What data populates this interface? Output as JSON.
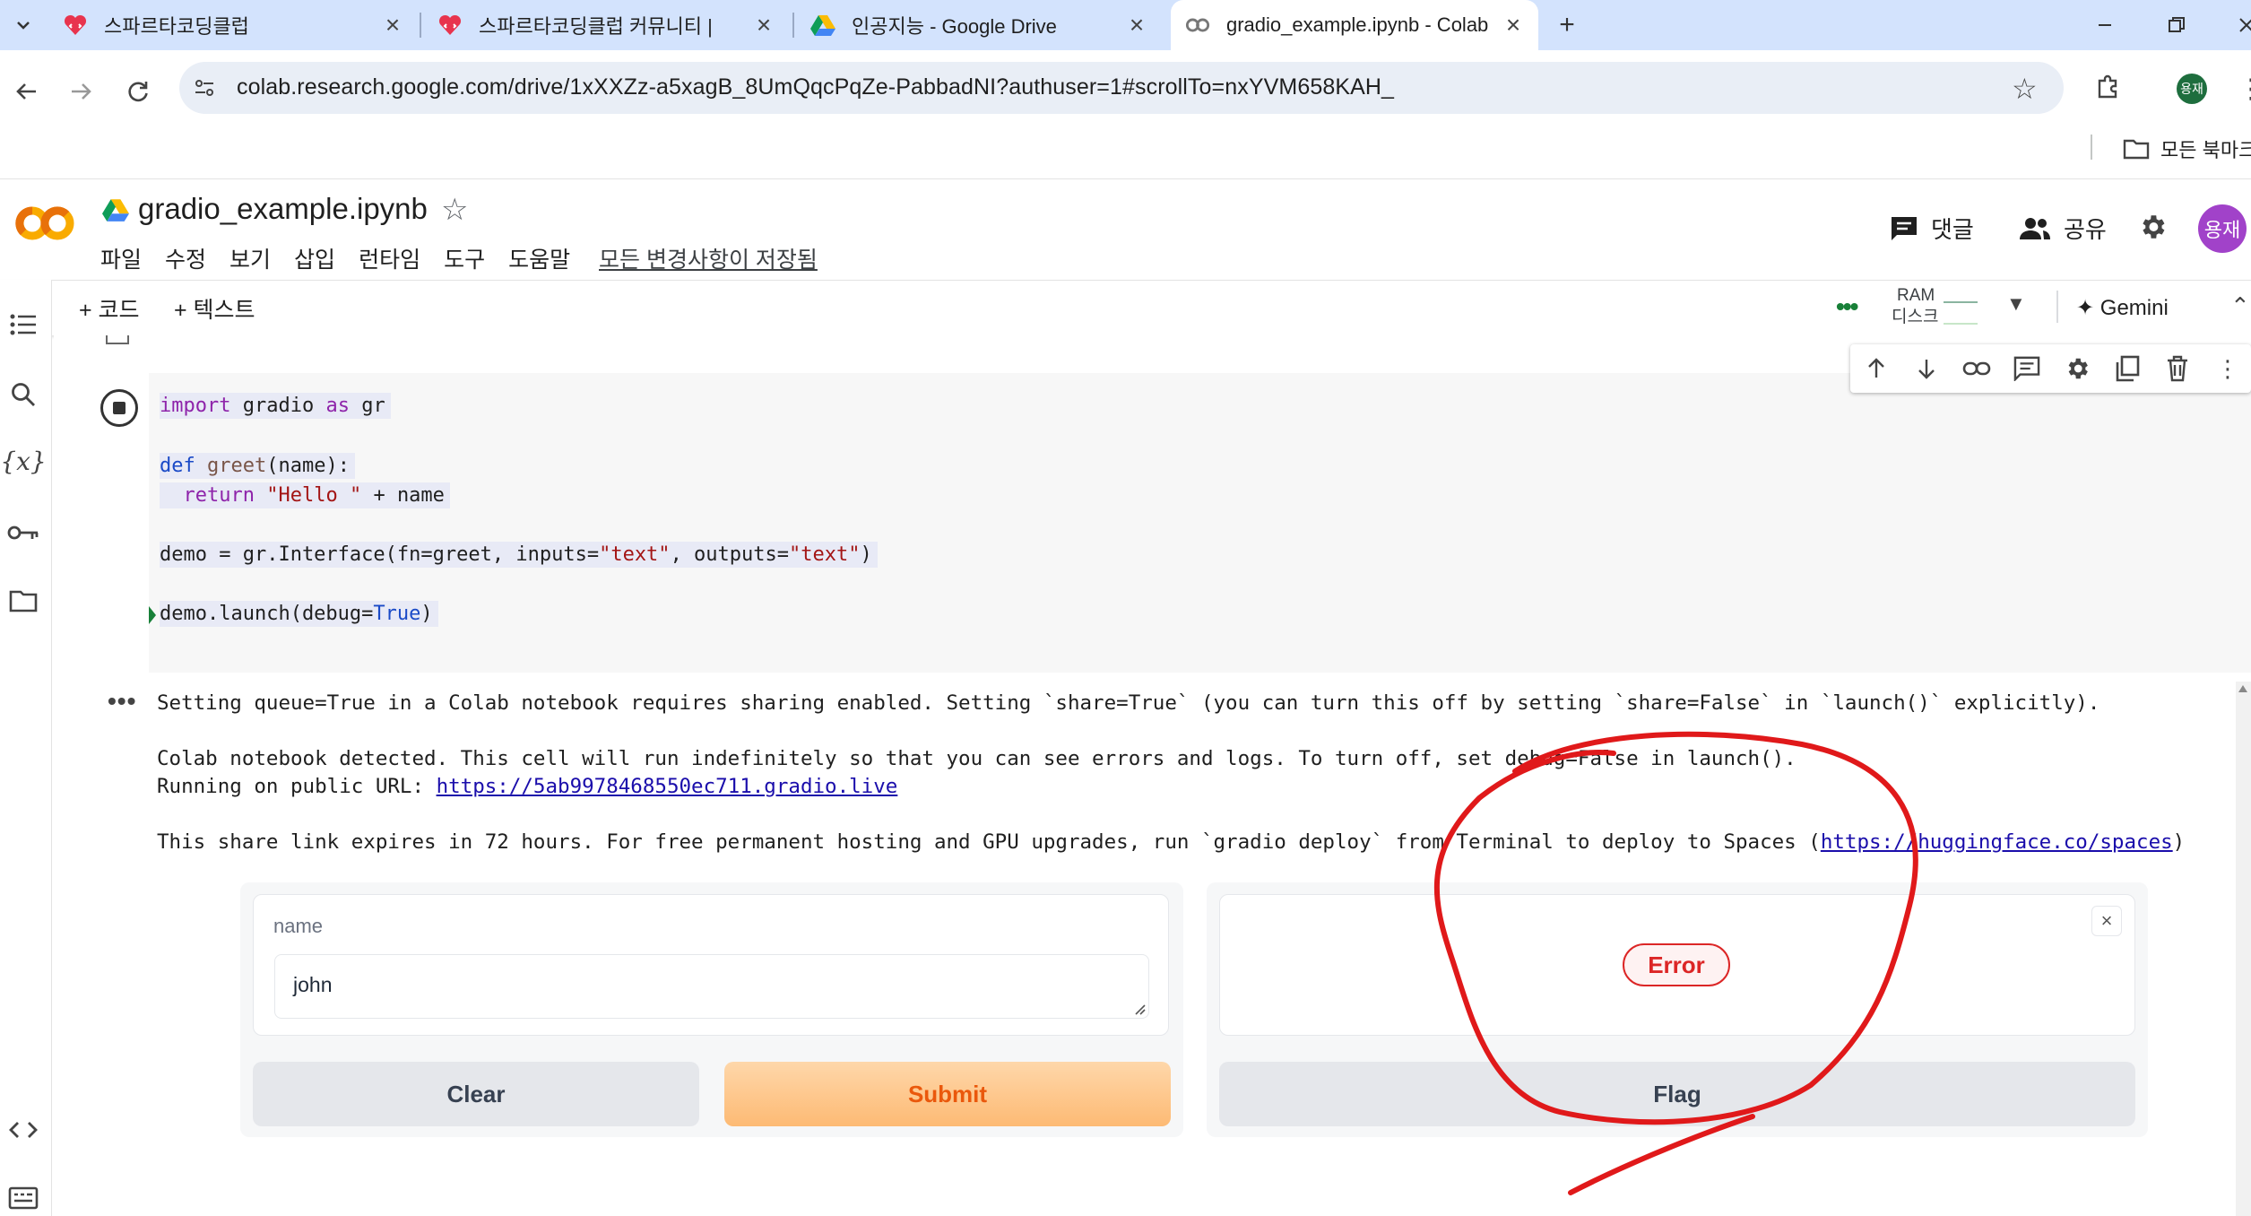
{
  "browser": {
    "tabs": [
      {
        "title": "스파르타코딩클럽",
        "icon": "heart-code-icon"
      },
      {
        "title": "스파르타코딩클럽 커뮤니티 | ",
        "icon": "heart-code-icon"
      },
      {
        "title": "인공지능 - Google Drive",
        "icon": "google-drive-icon"
      },
      {
        "title": "gradio_example.ipynb - Colab",
        "icon": "colab-icon"
      }
    ],
    "new_tab_label": "+",
    "url": "colab.research.google.com/drive/1xXXZz-a5xagB_8UmQqcPqZe-PabbadNI?authuser=1#scrollTo=nxYVM658KAH_",
    "profile_initials": "용재",
    "bookmarks_folder": "모든 북마크"
  },
  "colab": {
    "notebook_title": "gradio_example.ipynb",
    "menu": [
      "파일",
      "수정",
      "보기",
      "삽입",
      "런타임",
      "도구",
      "도움말"
    ],
    "save_status": "모든 변경사항이 저장됨",
    "comment_label": "댓글",
    "share_label": "공유",
    "avatar_initials": "용재",
    "toolbar": {
      "add_code": "+ 코드",
      "add_text": "+ 텍스트",
      "ram_label": "RAM",
      "disk_label": "디스크",
      "gemini_label": "Gemini"
    }
  },
  "cell": {
    "code_lines": [
      "import gradio as gr",
      "",
      "def greet(name):",
      "  return \"Hello \" + name",
      "",
      "demo = gr.Interface(fn=greet, inputs=\"text\", outputs=\"text\")",
      "",
      "demo.launch(debug=True)"
    ]
  },
  "output": {
    "line1": "Setting queue=True in a Colab notebook requires sharing enabled. Setting `share=True` (you can turn this off by setting `share=False` in `launch()` explicitly).",
    "line2": "Colab notebook detected. This cell will run indefinitely so that you can see errors and logs. To turn off, set debug=False in launch().",
    "line3_prefix": "Running on public URL: ",
    "line3_link": "https://5ab9978468550ec711.gradio.live",
    "line4_prefix": "This share link expires in 72 hours. For free permanent hosting and GPU upgrades, run `gradio deploy` from Terminal to deploy to Spaces (",
    "line4_link": "https://huggingface.co/spaces",
    "line4_suffix": ")"
  },
  "gradio": {
    "input_label": "name",
    "input_value": "john",
    "error_badge": "Error",
    "clear_button": "Clear",
    "submit_button": "Submit",
    "flag_button": "Flag"
  },
  "colors": {
    "annotation_red": "#e0191a",
    "submit_orange": "#ea580c",
    "error_red": "#dc2626",
    "colab_orange": "#f9ab00"
  }
}
